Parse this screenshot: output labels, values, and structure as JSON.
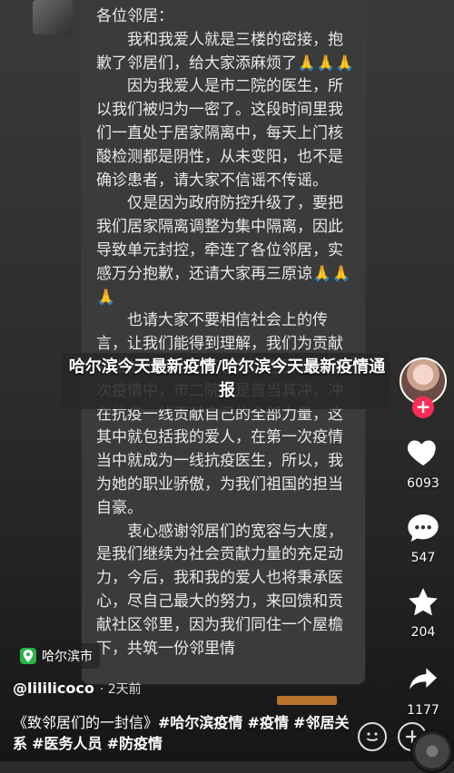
{
  "letter": {
    "lines": [
      "各位邻居：",
      "　　我和我爱人就是三楼的密接，抱歉了邻居们，给大家添麻烦了🙏🙏🙏",
      "　　因为我爱人是市二院的医生，所以我们被归为一密了。这段时间里我们一直处于居家隔离中，每天上门核酸检测都是阴性，从未变阳，也不是确诊患者，请大家不信谣不传谣。",
      "　　仅是因为政府防控升级了，要把我们居家隔离调整为集中隔离，因此导致单元封控，牵连了各位邻居，实感万分抱歉，还请大家再三原谅🙏🙏🙏",
      "　　也请大家不要相信社会上的传言，让我们能得到理解，我们为贡献社会的在职人员不容易。在历来的每次疫情中，市二院总是首当其冲，冲在抗疫一线贡献自己的全部力量，这其中就包括我的爱人，在第一次疫情当中就成为一线抗疫医生，所以，我为她的职业骄傲，为我们祖国的担当自豪。",
      "　　衷心感谢邻居们的宽容与大度，是我们继续为社会贡献力量的充足动力，今后，我和我的爱人也将秉承医心，尽自己最大的努力，来回馈和贡献社区邻里，因为我们同住一个屋檐下，共筑一份邻里情"
    ]
  },
  "title": "哈尔滨今天最新疫情/哈尔滨今天最新疫情通报",
  "right_rail": {
    "like_count": "6093",
    "comment_count": "547",
    "favorite_count": "204",
    "share_count": "1177"
  },
  "location": "哈尔滨市",
  "author": "@lililicoco",
  "time": "· 2天前",
  "caption": {
    "lead": "《致邻居们的一封信》",
    "tags": [
      "#哈尔滨疫情",
      "#疫情",
      "#邻居关系",
      "#医务人员",
      "#防疫情"
    ]
  },
  "colors": {
    "accent": "#fe2c55",
    "location_pin": "#2bb34a"
  },
  "icons": [
    "heart-icon",
    "comment-icon",
    "star-icon",
    "share-icon",
    "location-pin-icon",
    "emoji-icon",
    "plus-icon"
  ]
}
